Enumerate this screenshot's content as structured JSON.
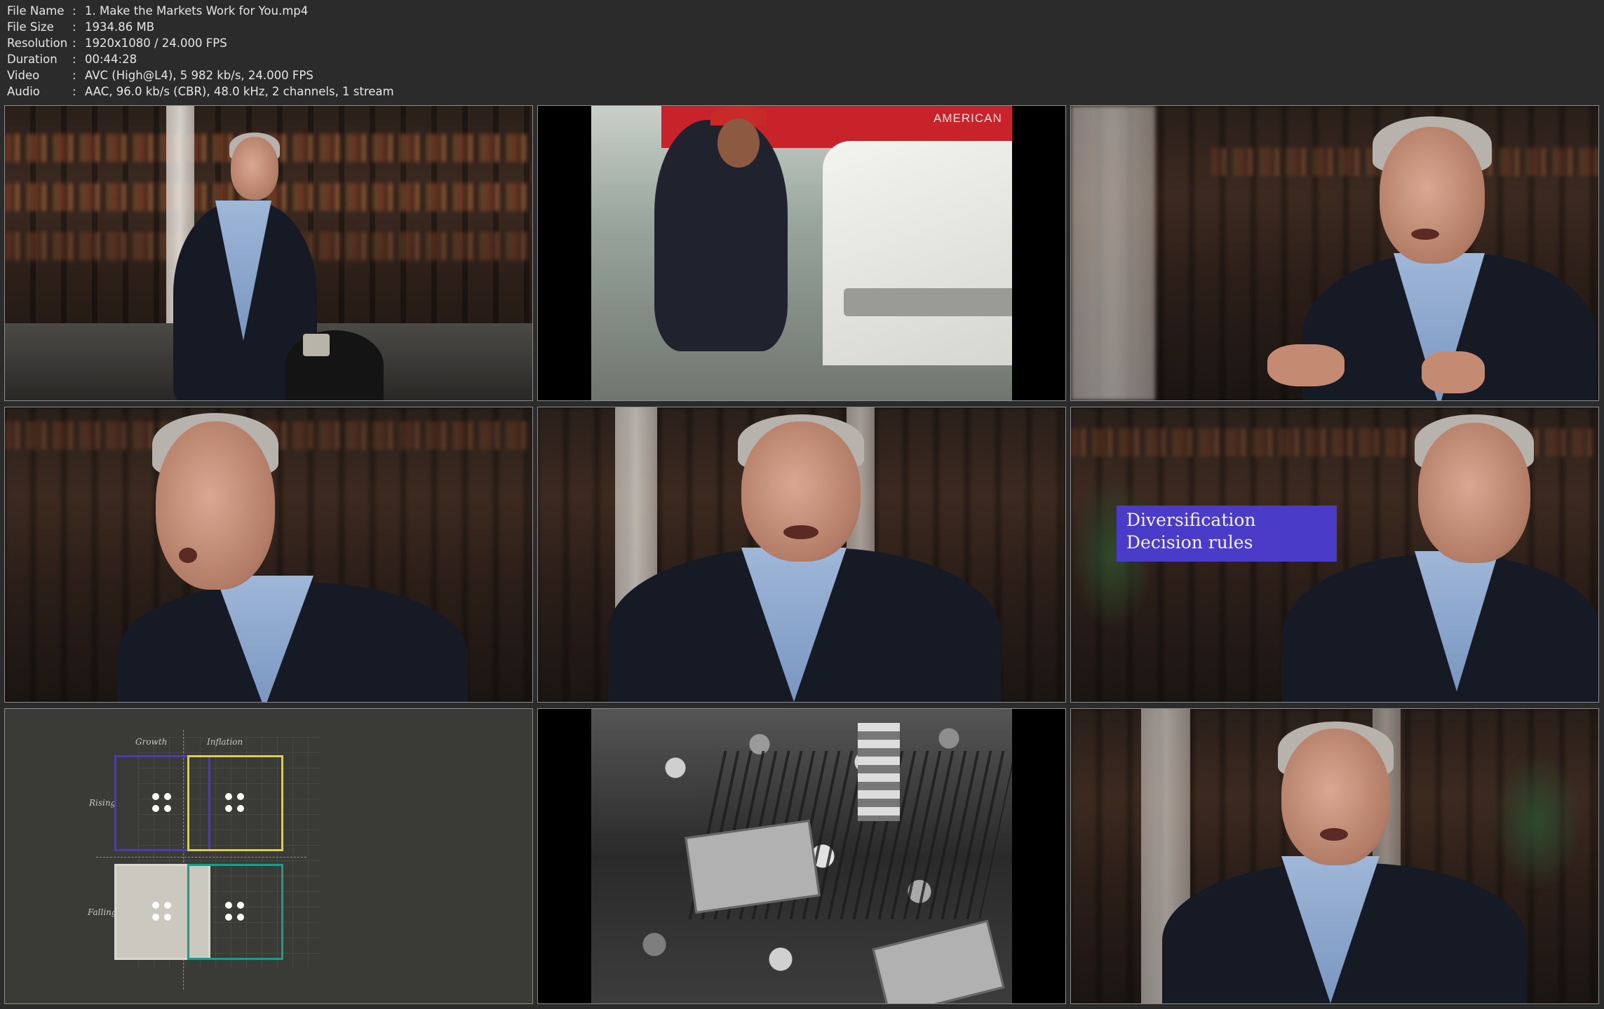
{
  "media_info": {
    "rows": [
      {
        "key": "File Name",
        "value": "1. Make the Markets Work for You.mp4"
      },
      {
        "key": "File Size",
        "value": "1934.86 MB"
      },
      {
        "key": "Resolution",
        "value": "1920x1080 / 24.000 FPS"
      },
      {
        "key": "Duration",
        "value": "00:44:28"
      },
      {
        "key": "Video",
        "value": "AVC (High@L4), 5 982 kb/s, 24.000 FPS"
      },
      {
        "key": "Audio",
        "value": "AAC, 96.0 kb/s (CBR), 48.0 kHz, 2 channels, 1 stream"
      }
    ],
    "separator": ":"
  },
  "frames": {
    "f2": {
      "truck_text": "AMERICAN"
    },
    "f6": {
      "title_lines": [
        "Diversification",
        "Decision rules"
      ],
      "card_color": "#4a3bc8"
    },
    "f7": {
      "col_labels": [
        "Growth",
        "Inflation"
      ],
      "row_labels": [
        "Rising",
        "Falling"
      ],
      "quadrant_colors": [
        "#4b35d6",
        "#e0d22b",
        "#dbd8cf",
        "#1f9b85"
      ]
    }
  }
}
